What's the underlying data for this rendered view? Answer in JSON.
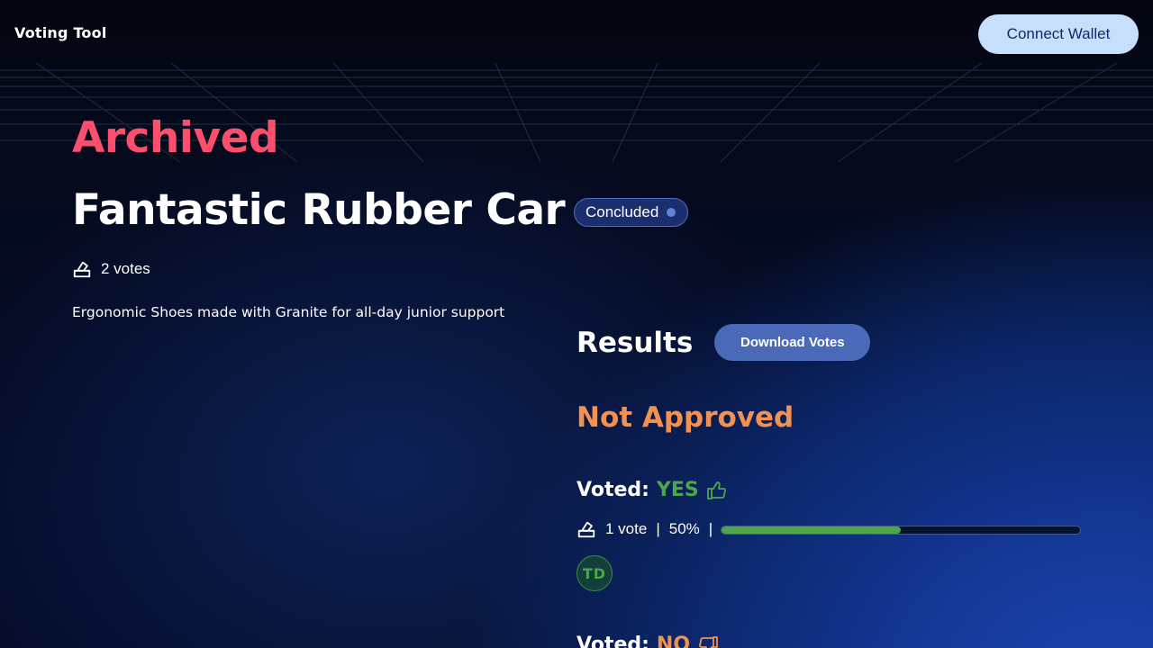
{
  "header": {
    "brand": "Voting Tool",
    "connect_label": "Connect Wallet"
  },
  "proposal": {
    "state_heading": "Archived",
    "title": "Fantastic Rubber Car",
    "status": "Concluded",
    "votes_total": "2 votes",
    "description": "Ergonomic Shoes made with Granite for all-day junior support"
  },
  "results": {
    "title": "Results",
    "download_label": "Download Votes",
    "verdict": "Not Approved",
    "options": [
      {
        "voted_label": "Voted:",
        "choice": "YES",
        "votes": "1 vote",
        "percent_text": "50%",
        "percent_value": 50,
        "voters": [
          "TD"
        ]
      },
      {
        "voted_label": "Voted:",
        "choice": "NO"
      }
    ]
  },
  "icons": {
    "ballot": "ballot-box-icon",
    "yes": "thumbs-up-icon",
    "no": "thumbs-down-icon"
  },
  "colors": {
    "archived": "#fc4f6e",
    "not_approved": "#f29150",
    "yes": "#4ea64c",
    "no": "#f29150",
    "connect_button": "#c8dffc",
    "download_button": "#4a69b8"
  }
}
